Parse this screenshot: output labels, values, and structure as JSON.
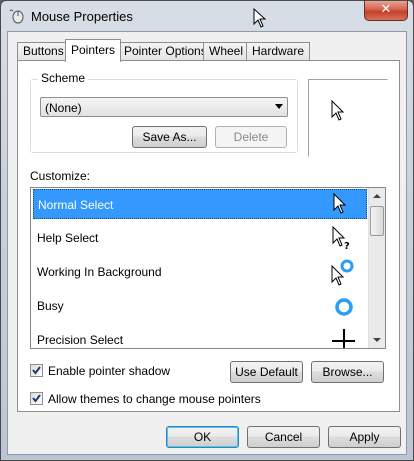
{
  "window": {
    "title": "Mouse Properties",
    "close_glyph": "✕",
    "app_icon": "mouse-icon"
  },
  "tabs": [
    {
      "label": "Buttons",
      "active": false
    },
    {
      "label": "Pointers",
      "active": true
    },
    {
      "label": "Pointer Options",
      "active": false
    },
    {
      "label": "Wheel",
      "active": false
    },
    {
      "label": "Hardware",
      "active": false
    }
  ],
  "scheme": {
    "group_label": "Scheme",
    "selected": "(None)",
    "save_as_label": "Save As...",
    "delete_label": "Delete",
    "delete_enabled": false
  },
  "preview": {
    "icon": "arrow-cursor-icon"
  },
  "customize": {
    "label": "Customize:",
    "items": [
      {
        "label": "Normal Select",
        "icon": "arrow-cursor-icon",
        "selected": true
      },
      {
        "label": "Help Select",
        "icon": "help-cursor-icon",
        "selected": false
      },
      {
        "label": "Working In Background",
        "icon": "working-cursor-icon",
        "selected": false
      },
      {
        "label": "Busy",
        "icon": "busy-ring-icon",
        "selected": false
      },
      {
        "label": "Precision Select",
        "icon": "crosshair-icon",
        "selected": false
      }
    ]
  },
  "options": {
    "shadow_label": "Enable pointer shadow",
    "shadow_checked": true,
    "themes_label": "Allow themes to change mouse pointers",
    "themes_checked": true
  },
  "buttons": {
    "use_default": "Use Default",
    "browse": "Browse...",
    "ok": "OK",
    "cancel": "Cancel",
    "apply": "Apply"
  },
  "colors": {
    "selection": "#3399ff",
    "busy_ring": "#2a9df4"
  }
}
